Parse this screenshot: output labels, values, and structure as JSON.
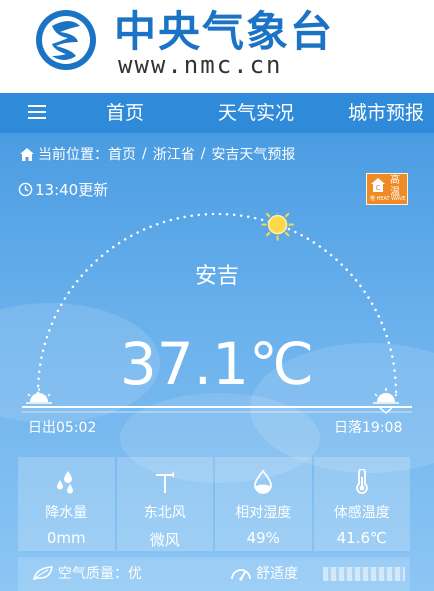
{
  "brand": {
    "name": "中央气象台",
    "url": "www.nmc.cn",
    "color": "#1b73c5"
  },
  "nav": {
    "items": [
      {
        "label": "首页"
      },
      {
        "label": "天气实况"
      },
      {
        "label": "城市预报"
      }
    ],
    "background": "#2f8bd9"
  },
  "breadcrumb": {
    "prefix": "当前位置：",
    "items": [
      "首页",
      "浙江省",
      "安吉天气预报"
    ],
    "separator": "/"
  },
  "update_time": "13:40更新",
  "alert": {
    "line1": "高",
    "line2": "温",
    "line3": "橙 HEAT WAVE",
    "color": "#f08a24"
  },
  "weather": {
    "city": "安吉",
    "temperature": "37.1℃",
    "sunrise": "日出05:02",
    "sunset": "日落19:08",
    "sun_progress": 0.61
  },
  "metrics": [
    {
      "label": "降水量",
      "value": "0mm",
      "icon": "raindrops-icon"
    },
    {
      "label": "东北风",
      "value": "微风",
      "icon": "wind-vane-icon"
    },
    {
      "label": "相对湿度",
      "value": "49%",
      "icon": "humidity-drop-icon"
    },
    {
      "label": "体感温度",
      "value": "41.6℃",
      "icon": "thermometer-icon"
    }
  ],
  "footer": {
    "air_quality": "空气质量：优",
    "comfort": "舒适度"
  }
}
